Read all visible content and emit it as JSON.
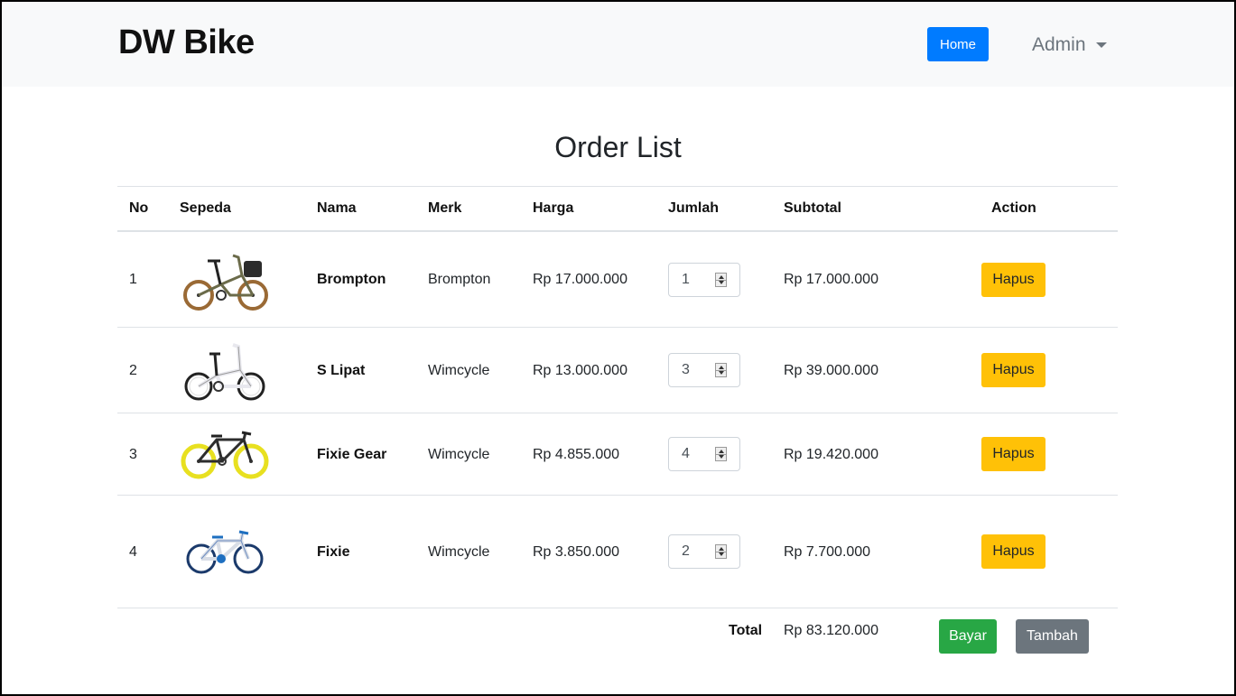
{
  "navbar": {
    "brand": "DW Bike",
    "home_label": "Home",
    "user_label": "Admin"
  },
  "page": {
    "title": "Order List"
  },
  "table": {
    "headers": [
      "No",
      "Sepeda",
      "Nama",
      "Merk",
      "Harga",
      "Jumlah",
      "Subtotal",
      "Action"
    ],
    "rows": [
      {
        "no": "1",
        "nama": "Brompton",
        "merk": "Brompton",
        "harga": "Rp 17.000.000",
        "jumlah": "1",
        "subtotal": "Rp 17.000.000",
        "action": "Hapus"
      },
      {
        "no": "2",
        "nama": "S Lipat",
        "merk": "Wimcycle",
        "harga": "Rp 13.000.000",
        "jumlah": "3",
        "subtotal": "Rp 39.000.000",
        "action": "Hapus"
      },
      {
        "no": "3",
        "nama": "Fixie Gear",
        "merk": "Wimcycle",
        "harga": "Rp 4.855.000",
        "jumlah": "4",
        "subtotal": "Rp 19.420.000",
        "action": "Hapus"
      },
      {
        "no": "4",
        "nama": "Fixie",
        "merk": "Wimcycle",
        "harga": "Rp 3.850.000",
        "jumlah": "2",
        "subtotal": "Rp 7.700.000",
        "action": "Hapus"
      }
    ]
  },
  "footer": {
    "total_label": "Total",
    "total_value": "Rp 83.120.000",
    "pay_label": "Bayar",
    "add_label": "Tambah"
  },
  "colors": {
    "primary": "#007bff",
    "warning": "#ffc107",
    "success": "#28a745",
    "secondary": "#6c757d"
  },
  "icons": [
    "caret-down-icon",
    "spinner-icon"
  ]
}
